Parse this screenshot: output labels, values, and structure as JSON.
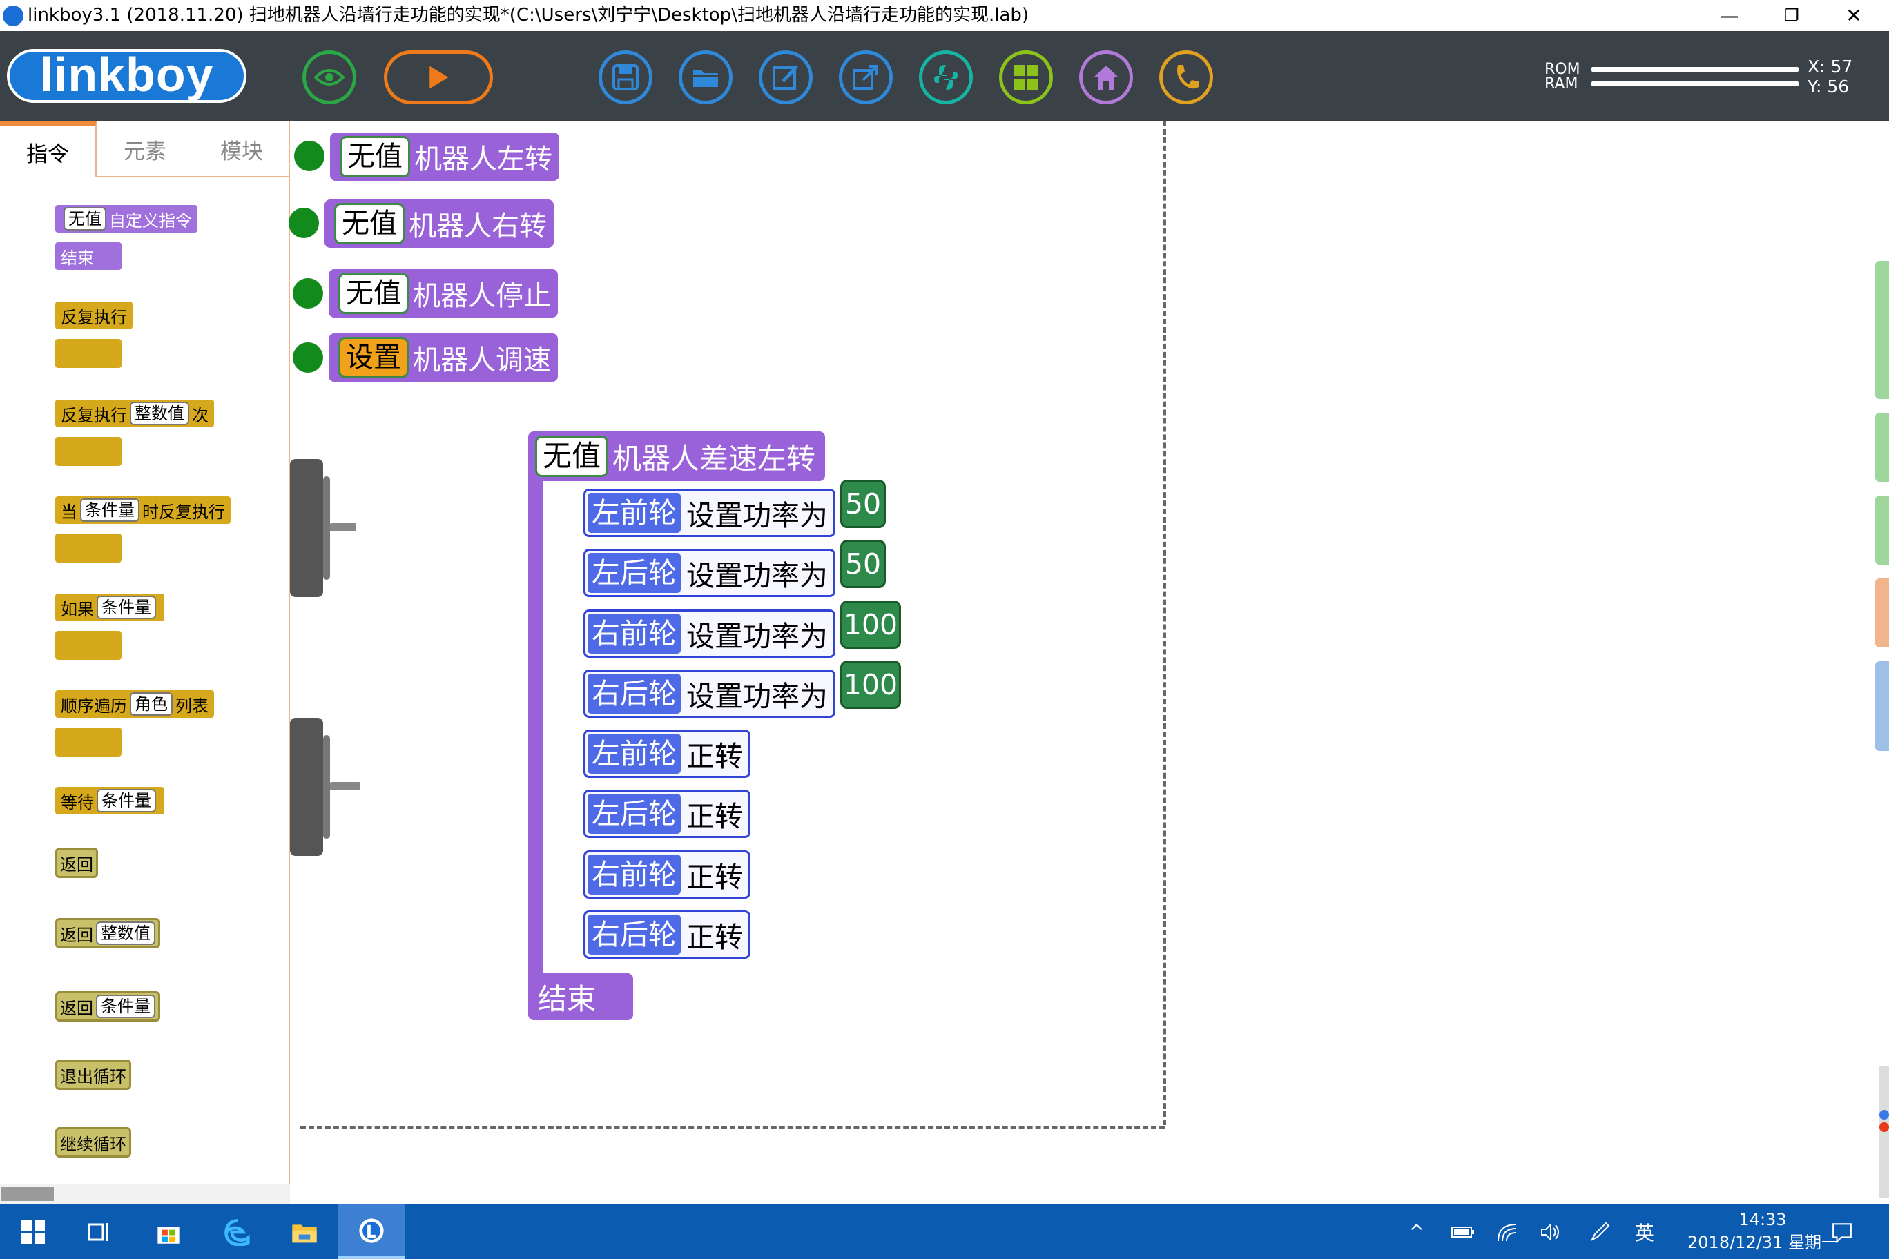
{
  "window": {
    "title": "linkboy3.1 (2018.11.20) 扫地机器人沿墙行走功能的实现*(C:\\Users\\刘宁宁\\Desktop\\扫地机器人沿墙行走功能的实现.lab)",
    "minimize": "—",
    "restore": "❐",
    "close": "✕"
  },
  "toolbar": {
    "logo": "linkboy",
    "rom_label": "ROM",
    "ram_label": "RAM",
    "x_readout": "X: 57",
    "y_readout": "Y: 56",
    "icons": [
      "eye-icon",
      "run-icon",
      "save-icon",
      "open-folder-icon",
      "edit-icon",
      "export-icon",
      "python-icon",
      "grid-icon",
      "home-icon",
      "phone-icon"
    ]
  },
  "left_panel": {
    "tabs": [
      {
        "label": "指令"
      },
      {
        "label": "元素"
      },
      {
        "label": "模块"
      }
    ],
    "blocks": {
      "custom_cmd_slot": "无值",
      "custom_cmd_label": "自定义指令",
      "custom_cmd_end": "结束",
      "repeat": "反复执行",
      "repeat_n_pre": "反复执行",
      "repeat_n_slot": "整数值",
      "repeat_n_post": "次",
      "while_pre": "当",
      "while_slot": "条件量",
      "while_post": "时反复执行",
      "if_label": "如果",
      "if_slot": "条件量",
      "foreach_pre": "顺序遍历",
      "foreach_slot": "角色",
      "foreach_post": "列表",
      "wait_label": "等待",
      "wait_slot": "条件量",
      "return": "返回",
      "return_int_label": "返回",
      "return_int_slot": "整数值",
      "return_cond_label": "返回",
      "return_cond_slot": "条件量",
      "break": "退出循环",
      "continue": "继续循环"
    }
  },
  "canvas": {
    "events": [
      {
        "slot": "无值",
        "label": "机器人左转"
      },
      {
        "slot": "无值",
        "label": "机器人右转"
      },
      {
        "slot": "无值",
        "label": "机器人停止"
      },
      {
        "slot": "设置",
        "label": "机器人调速"
      }
    ],
    "function": {
      "slot": "无值",
      "label": "机器人差速左转",
      "end": "结束",
      "statements": [
        {
          "wheel": "左前轮",
          "action": "设置功率为",
          "value": "50"
        },
        {
          "wheel": "左后轮",
          "action": "设置功率为",
          "value": "50"
        },
        {
          "wheel": "右前轮",
          "action": "设置功率为",
          "value": "100"
        },
        {
          "wheel": "右后轮",
          "action": "设置功率为",
          "value": "100"
        },
        {
          "wheel": "左前轮",
          "action": "正转"
        },
        {
          "wheel": "左后轮",
          "action": "正转"
        },
        {
          "wheel": "右前轮",
          "action": "正转"
        },
        {
          "wheel": "右后轮",
          "action": "正转"
        }
      ]
    }
  },
  "taskbar": {
    "ime": "英",
    "time": "14:33",
    "date": "2018/12/31 星期一"
  },
  "colors": {
    "toolbar_bg": "#3a4248",
    "event_block": "#9a62d8",
    "control_block": "#d6a81c",
    "wheel_label": "#4f6ae6",
    "number_block": "#2e8a4a",
    "taskbar": "#0b5bb0"
  }
}
